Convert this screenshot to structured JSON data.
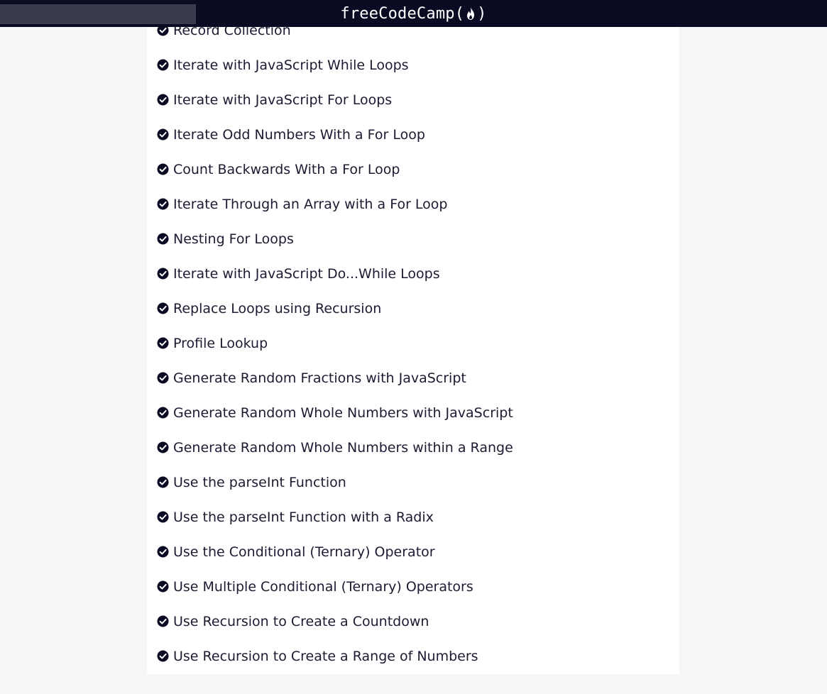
{
  "topbar": {
    "search_placeholder": "",
    "logo": {
      "prefix": "freeCodeCamp(",
      "suffix": ")",
      "icon": "flame-icon"
    }
  },
  "colors": {
    "nav": "#0a0a23",
    "check": "#0a0a23",
    "text": "#1b1b32",
    "page_bg": "#f5f6f7"
  },
  "challenges": [
    {
      "label": "Record Collection",
      "completed": true
    },
    {
      "label": "Iterate with JavaScript While Loops",
      "completed": true
    },
    {
      "label": "Iterate with JavaScript For Loops",
      "completed": true
    },
    {
      "label": "Iterate Odd Numbers With a For Loop",
      "completed": true
    },
    {
      "label": "Count Backwards With a For Loop",
      "completed": true
    },
    {
      "label": "Iterate Through an Array with a For Loop",
      "completed": true
    },
    {
      "label": "Nesting For Loops",
      "completed": true
    },
    {
      "label": "Iterate with JavaScript Do...While Loops",
      "completed": true
    },
    {
      "label": "Replace Loops using Recursion",
      "completed": true
    },
    {
      "label": "Profile Lookup",
      "completed": true
    },
    {
      "label": "Generate Random Fractions with JavaScript",
      "completed": true
    },
    {
      "label": "Generate Random Whole Numbers with JavaScript",
      "completed": true
    },
    {
      "label": "Generate Random Whole Numbers within a Range",
      "completed": true
    },
    {
      "label": "Use the parseInt Function",
      "completed": true
    },
    {
      "label": "Use the parseInt Function with a Radix",
      "completed": true
    },
    {
      "label": "Use the Conditional (Ternary) Operator",
      "completed": true
    },
    {
      "label": "Use Multiple Conditional (Ternary) Operators",
      "completed": true
    },
    {
      "label": "Use Recursion to Create a Countdown",
      "completed": true
    },
    {
      "label": "Use Recursion to Create a Range of Numbers",
      "completed": true
    }
  ]
}
